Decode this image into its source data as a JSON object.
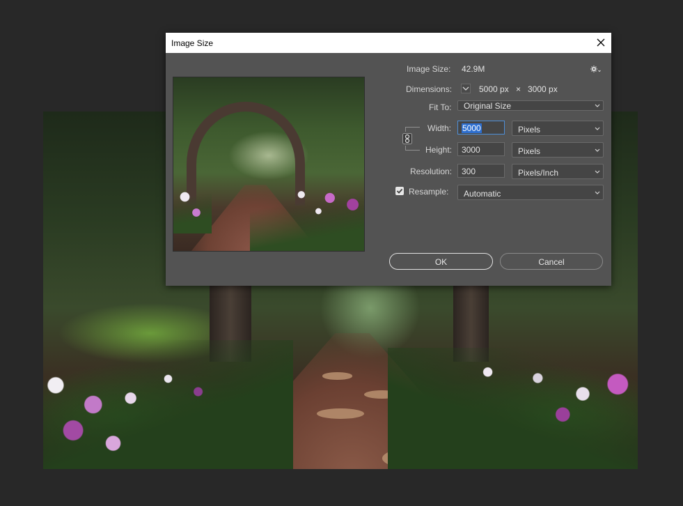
{
  "dialog": {
    "title": "Image Size",
    "image_size_label": "Image Size:",
    "image_size_value": "42.9M",
    "dimensions_label": "Dimensions:",
    "dim_width": "5000 px",
    "dim_times": "×",
    "dim_height": "3000 px",
    "fit_to_label": "Fit To:",
    "fit_to_value": "Original Size",
    "width_label": "Width:",
    "width_value": "5000",
    "width_unit": "Pixels",
    "height_label": "Height:",
    "height_value": "3000",
    "height_unit": "Pixels",
    "resolution_label": "Resolution:",
    "resolution_value": "300",
    "resolution_unit": "Pixels/Inch",
    "resample_label": "Resample:",
    "resample_checked": true,
    "resample_value": "Automatic",
    "ok_label": "OK",
    "cancel_label": "Cancel"
  },
  "icons": {
    "close": "close-icon",
    "settings": "gear-icon",
    "dimensions_toggle": "chevron-down-icon",
    "constrain": "link-icon",
    "checkbox": "checkmark-icon"
  },
  "colors": {
    "dialog_bg": "#535353",
    "titlebar_bg": "#ffffff",
    "workspace_bg": "#282828",
    "focus_border": "#4e8fd8",
    "selection": "#2d6fd0"
  }
}
